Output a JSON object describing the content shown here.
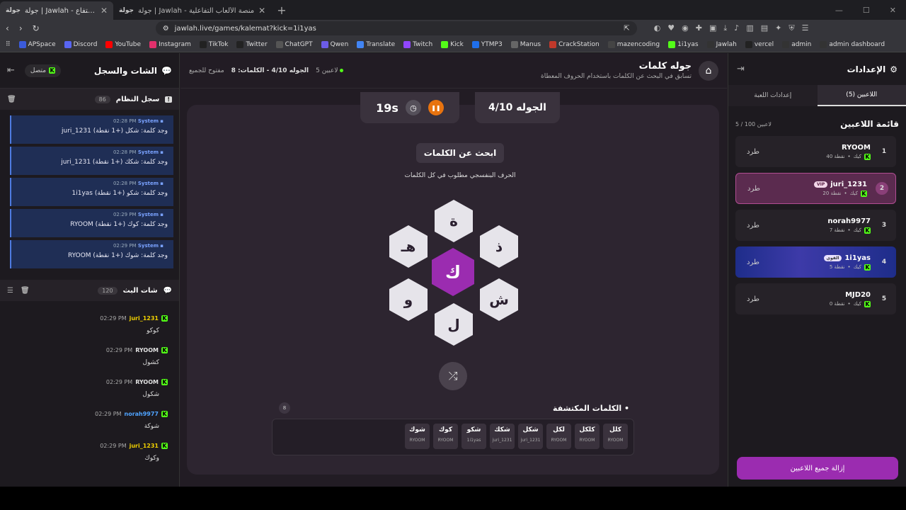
{
  "browser": {
    "tabs": [
      {
        "favicon": "جولة",
        "title": "جولة | Jawlah - منصة الألعاب التفاع"
      },
      {
        "favicon": "جولة",
        "title": "جولة | Jawlah - منصة الألعاب التفاعلية"
      }
    ],
    "url": "jawlah.live/games/kalemat?kick=1i1yas",
    "bookmarks": [
      {
        "label": "APSpace",
        "color": "#3b5bdb"
      },
      {
        "label": "Discord",
        "color": "#5865f2"
      },
      {
        "label": "YouTube",
        "color": "#ff0000"
      },
      {
        "label": "Instagram",
        "color": "#e1306c"
      },
      {
        "label": "TikTok",
        "color": "#222"
      },
      {
        "label": "Twitter",
        "color": "#222"
      },
      {
        "label": "ChatGPT",
        "color": "#555"
      },
      {
        "label": "Qwen",
        "color": "#6c5ce7"
      },
      {
        "label": "Translate",
        "color": "#4285f4"
      },
      {
        "label": "Twitch",
        "color": "#9146ff"
      },
      {
        "label": "Kick",
        "color": "#53fc18"
      },
      {
        "label": "YTMP3",
        "color": "#1f6feb"
      },
      {
        "label": "Manus",
        "color": "#666"
      },
      {
        "label": "CrackStation",
        "color": "#c0392b"
      },
      {
        "label": "mazencoding",
        "color": "#444"
      },
      {
        "label": "1i1yas",
        "color": "#53fc18"
      },
      {
        "label": "Jawlah",
        "color": "#333"
      },
      {
        "label": "vercel",
        "color": "#222"
      },
      {
        "label": "admin",
        "color": "#333"
      },
      {
        "label": "admin dashboard",
        "color": "#333"
      }
    ]
  },
  "chat": {
    "title": "الشات والسجل",
    "status": "متصل",
    "system_log_title": "سجل النظام",
    "system_log_count": "86",
    "system_messages": [
      {
        "sender": "System",
        "time": "02:28 PM",
        "text": "juri_1231 وجد كلمة: شكل (+1 نقطة)"
      },
      {
        "sender": "System",
        "time": "02:28 PM",
        "text": "juri_1231 وجد كلمة: شكك (+1 نقطة)"
      },
      {
        "sender": "System",
        "time": "02:28 PM",
        "text": "1i1yas وجد كلمة: شكو (+1 نقطة)"
      },
      {
        "sender": "System",
        "time": "02:29 PM",
        "text": "RYOOM وجد كلمة: كوك (+1 نقطة)"
      },
      {
        "sender": "System",
        "time": "02:29 PM",
        "text": "RYOOM وجد كلمة: شوك (+1 نقطة)"
      }
    ],
    "live_title": "شات البث",
    "live_count": "120",
    "live_messages": [
      {
        "user": "juri_1231",
        "color": "#f0d000",
        "time": "02:29 PM",
        "text": "كوكو"
      },
      {
        "user": "RYOOM",
        "color": "#e0e0e0",
        "time": "02:29 PM",
        "text": "كشول"
      },
      {
        "user": "RYOOM",
        "color": "#e0e0e0",
        "time": "02:29 PM",
        "text": "شكول"
      },
      {
        "user": "norah9977",
        "color": "#4fa3ff",
        "time": "02:29 PM",
        "text": "شوكة"
      },
      {
        "user": "juri_1231",
        "color": "#f0d000",
        "time": "02:29 PM",
        "text": "وكوك"
      }
    ]
  },
  "game": {
    "title": "جوله كلمات",
    "subtitle": "تسابق في البحث عن الكلمات باستخدام الحروف المعطاة",
    "players_info": "5 لاعبين",
    "round_info": "الجوله 4/10 - الكلمات: 8",
    "open_info": "مفتوح للجميع",
    "timer": "19s",
    "round": "الجوله 4/10",
    "search_label": "ابحث عن الكلمات",
    "hint": "الحرف البنفسجي مطلوب في كل الكلمات",
    "letters": {
      "center": "ك",
      "top": "ة",
      "top_left": "هـ",
      "top_right": "ذ",
      "bottom_left": "و",
      "bottom_right": "ش",
      "bottom": "ل"
    },
    "found_title": "الكلمات المكتشفة",
    "found_count": "8",
    "found_words": [
      {
        "word": "كلل",
        "by": "RYOOM"
      },
      {
        "word": "كلكل",
        "by": "RYOOM"
      },
      {
        "word": "لكل",
        "by": "RYOOM"
      },
      {
        "word": "شكل",
        "by": "juri_1231"
      },
      {
        "word": "شكك",
        "by": "juri_1231"
      },
      {
        "word": "شكو",
        "by": "1i1yas"
      },
      {
        "word": "كوك",
        "by": "RYOOM"
      },
      {
        "word": "شوك",
        "by": "RYOOM"
      }
    ],
    "accent": "#9b2cb0"
  },
  "settings": {
    "title": "الإعدادات",
    "tab_players": "اللاعبين (5)",
    "tab_game": "إعدادات اللعبة",
    "list_title": "قائمة اللاعبين",
    "list_count": "5 / 100 لاعبين",
    "kick_label": "طرد",
    "remove_all": "إزالة جميع اللاعبين",
    "players": [
      {
        "rank": "1",
        "name": "RYOOM",
        "platform": "كيك",
        "points": "40 نقطة",
        "tag": ""
      },
      {
        "rank": "2",
        "name": "juri_1231",
        "platform": "كيك",
        "points": "20 نقطة",
        "tag": "VIP"
      },
      {
        "rank": "3",
        "name": "norah9977",
        "platform": "كيك",
        "points": "7 نقطة",
        "tag": ""
      },
      {
        "rank": "4",
        "name": "1i1yas",
        "platform": "كيك",
        "points": "5 نقطة",
        "tag": "القوي"
      },
      {
        "rank": "5",
        "name": "MJD20",
        "platform": "كيك",
        "points": "0 نقطة",
        "tag": ""
      }
    ]
  }
}
